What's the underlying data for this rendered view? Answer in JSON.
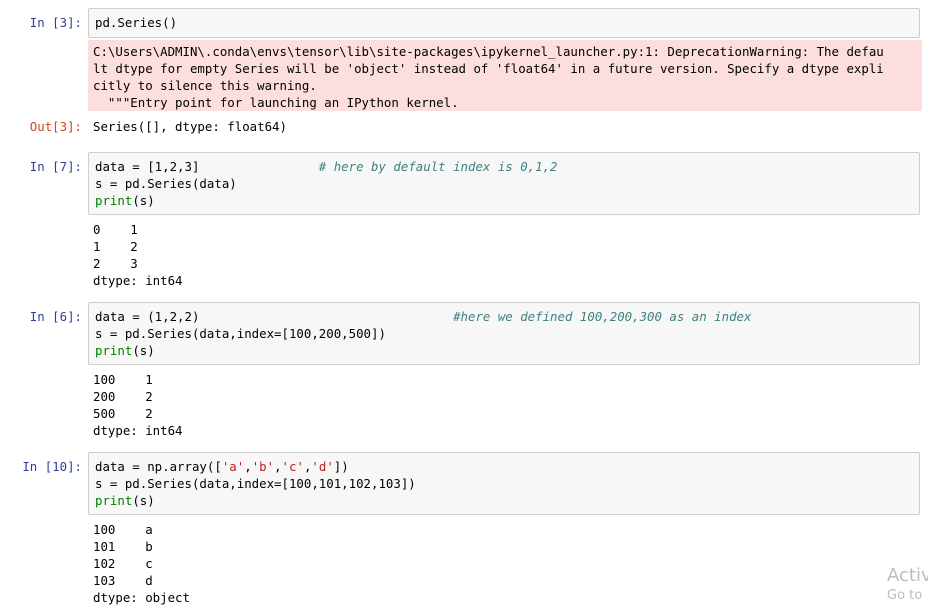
{
  "cells": [
    {
      "in_prompt": "In [3]:",
      "code": [
        "pd.Series()"
      ],
      "warning": "C:\\Users\\ADMIN\\.conda\\envs\\tensor\\lib\\site-packages\\ipykernel_launcher.py:1: DeprecationWarning: The defau\nlt dtype for empty Series will be 'object' instead of 'float64' in a future version. Specify a dtype expli\ncitly to silence this warning.\n  \"\"\"Entry point for launching an IPython kernel.",
      "out_prompt": "Out[3]:",
      "out_text": "Series([], dtype: float64)"
    },
    {
      "in_prompt": "In [7]:",
      "code_line1": "data = [1,2,3]",
      "code_line1_comment": "# here by default index is 0,1,2",
      "code_line2": "s = pd.Series(data)",
      "print_kw": "print",
      "print_arg": "(s)",
      "output": "0    1\n1    2\n2    3\ndtype: int64"
    },
    {
      "in_prompt": "In [6]:",
      "code_line1": "data = (1,2,2)",
      "code_line1_comment": "#here we defined 100,200,300 as an index",
      "code_line2": "s = pd.Series(data,index=[100,200,500])",
      "print_kw": "print",
      "print_arg": "(s)",
      "output": "100    1\n200    2\n500    2\ndtype: int64"
    },
    {
      "in_prompt": "In [10]:",
      "code_line1_pre": "data = np.array([",
      "strings": [
        "'a'",
        "'b'",
        "'c'",
        "'d'"
      ],
      "code_line1_post": "])",
      "code_line2": "s = pd.Series(data,index=[100,101,102,103])",
      "print_kw": "print",
      "print_arg": "(s)",
      "output": "100    a\n101    b\n102    c\n103    d\ndtype: object"
    }
  ],
  "watermark": {
    "line1": "Activ",
    "line2": "Go to"
  }
}
